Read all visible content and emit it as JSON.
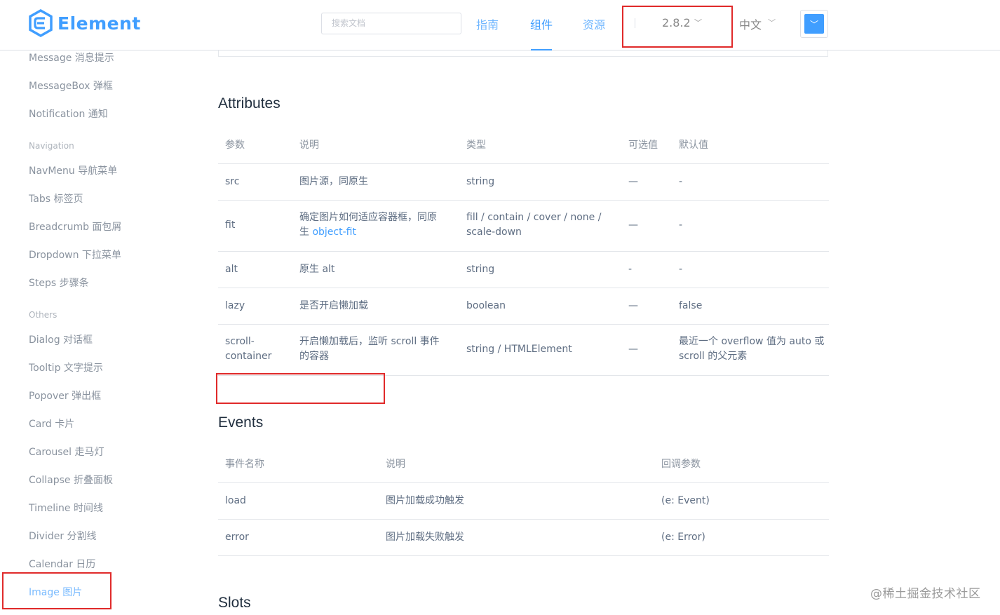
{
  "header": {
    "logo_text": "Element",
    "search_placeholder": "搜索文档",
    "nav": [
      "指南",
      "组件",
      "资源"
    ],
    "version": "2.8.2",
    "language": "中文",
    "accent": "#409eff"
  },
  "sidebar": {
    "items_top": [
      "Message 消息提示",
      "MessageBox 弹框",
      "Notification 通知"
    ],
    "group_navigation": "Navigation",
    "items_navigation": [
      "NavMenu 导航菜单",
      "Tabs 标签页",
      "Breadcrumb 面包屑",
      "Dropdown 下拉菜单",
      "Steps 步骤条"
    ],
    "group_others": "Others",
    "items_others": [
      "Dialog 对话框",
      "Tooltip 文字提示",
      "Popover 弹出框",
      "Card 卡片",
      "Carousel 走马灯",
      "Collapse 折叠面板",
      "Timeline 时间线",
      "Divider 分割线",
      "Calendar 日历",
      "Image 图片"
    ]
  },
  "attributes": {
    "title": "Attributes",
    "headers": [
      "参数",
      "说明",
      "类型",
      "可选值",
      "默认值"
    ],
    "rows": [
      {
        "param": "src",
        "desc": "图片源，同原生",
        "type": "string",
        "options": "—",
        "default": "-"
      },
      {
        "param": "fit",
        "desc1": "确定图片如何适应容器框，同原",
        "desc2": "生 ",
        "desc_link": "object-fit",
        "type1": "fill / contain / cover / none /",
        "type2": "scale-down",
        "options": "—",
        "default": "-"
      },
      {
        "param": "alt",
        "desc": "原生 alt",
        "type": "string",
        "options": "-",
        "default": "-"
      },
      {
        "param": "lazy",
        "desc": "是否开启懒加载",
        "type": "boolean",
        "options": "—",
        "default": "false"
      },
      {
        "param1": "scroll-",
        "param2": "container",
        "desc1": "开启懒加载后，监听 scroll 事件",
        "desc2": "的容器",
        "type": "string / HTMLElement",
        "options": "—",
        "default1": "最近一个 overflow 值为 auto 或",
        "default2": "scroll 的父元素"
      }
    ]
  },
  "events": {
    "title": "Events",
    "headers": [
      "事件名称",
      "说明",
      "回调参数"
    ],
    "rows": [
      {
        "name": "load",
        "desc": "图片加载成功触发",
        "args": "(e: Event)"
      },
      {
        "name": "error",
        "desc": "图片加载失败触发",
        "args": "(e: Error)"
      }
    ]
  },
  "slots": {
    "title": "Slots"
  },
  "watermark": "@稀土掘金技术社区"
}
